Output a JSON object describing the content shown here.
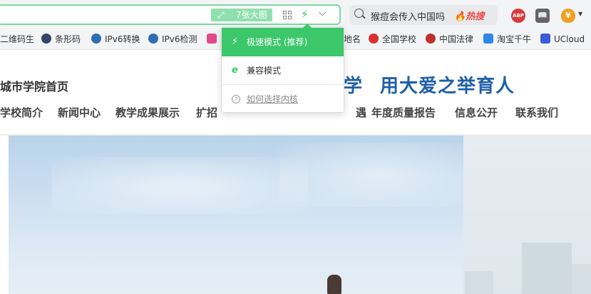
{
  "toolbar": {
    "big_images_label": "7张大图",
    "search": {
      "query": "猴痘会传入中国吗",
      "hot_label": "热搜"
    },
    "extensions": {
      "abp_label": "ABP",
      "coin_label": "¥"
    }
  },
  "bookmarks": [
    {
      "label": "二维码生",
      "icon_color": "#ffffff"
    },
    {
      "label": "条形码",
      "icon_color": "#334466"
    },
    {
      "label": "IPv6转换",
      "icon_color": "#2c6fb3"
    },
    {
      "label": "IPv6检测",
      "icon_color": "#2c6fb3"
    },
    {
      "label": "",
      "icon_color": "#e24b8a"
    },
    {
      "label": "地名",
      "icon_color": "#ffffff"
    },
    {
      "label": "全国学校",
      "icon_color": "#d9312c"
    },
    {
      "label": "中国法律",
      "icon_color": "#c0302a"
    },
    {
      "label": "淘宝千牛",
      "icon_color": "#2f86e8"
    },
    {
      "label": "UCloud",
      "icon_color": "#3b5bdb"
    }
  ],
  "dropdown": {
    "fast_mode": "极速模式 (推荐)",
    "compat_mode": "兼容模式",
    "how_to_choose": "如何选择内核"
  },
  "page": {
    "home_link": "城市学院首页",
    "slogan_left": "学",
    "slogan_right": "用大爱之举育人",
    "nav": [
      "学校简介",
      "新闻中心",
      "教学成果展示",
      "扩招",
      "年度质量报告",
      "信息公开",
      "联系我们"
    ],
    "nav_partial_hidden": "遇"
  },
  "colors": {
    "accent_green": "#3cc76b",
    "slogan_blue": "#1e5fa8",
    "hot_red": "#f04a4a"
  }
}
